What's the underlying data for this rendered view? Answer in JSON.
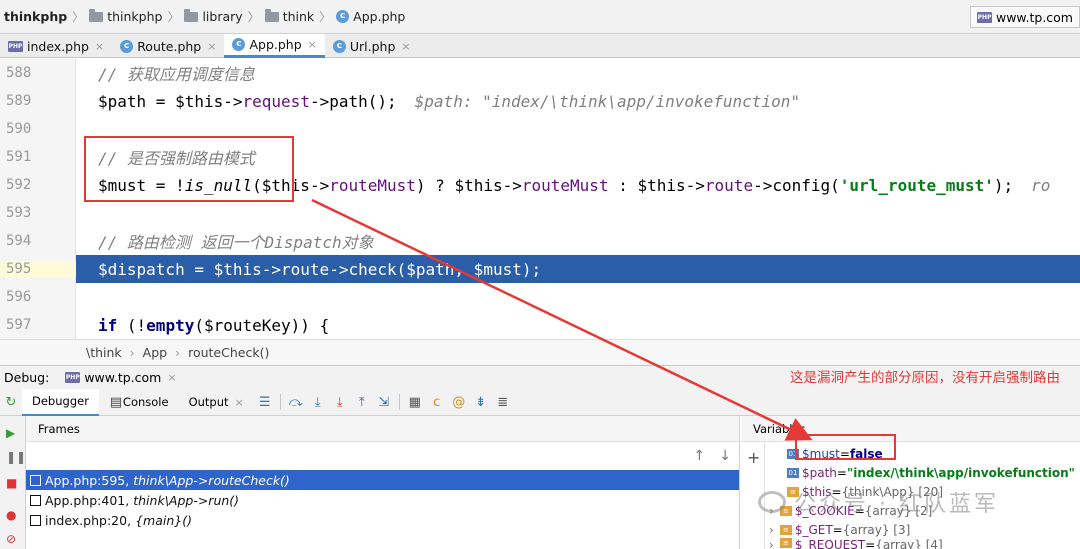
{
  "breadcrumb": {
    "items": [
      "thinkphp",
      "thinkphp",
      "library",
      "think",
      "App.php"
    ]
  },
  "run_config": {
    "label": "www.tp.com"
  },
  "tabs": [
    {
      "label": "index.php",
      "icon": "php-file-icon",
      "active": false,
      "close": "×"
    },
    {
      "label": "Route.php",
      "icon": "class-icon",
      "active": false,
      "close": "×"
    },
    {
      "label": "App.php",
      "icon": "class-icon",
      "active": true,
      "close": "×"
    },
    {
      "label": "Url.php",
      "icon": "class-icon",
      "active": false,
      "close": "×"
    }
  ],
  "editor": {
    "lines": [
      {
        "num": "588"
      },
      {
        "num": "589"
      },
      {
        "num": "590"
      },
      {
        "num": "591"
      },
      {
        "num": "592"
      },
      {
        "num": "593"
      },
      {
        "num": "594"
      },
      {
        "num": "595"
      },
      {
        "num": "596"
      },
      {
        "num": "597"
      }
    ],
    "code": {
      "l588_comment": "// 获取应用调度信息",
      "l589_a": "$path",
      "l589_b": " = ",
      "l589_c": "$this",
      "l589_d": "->",
      "l589_e": "request",
      "l589_f": "->path();",
      "l589_hint": "$path: \"index/\\think\\app/invokefunction\"",
      "l591_comment": "// 是否强制路由模式",
      "l592_a": "$must",
      "l592_b": " = !",
      "l592_c": "is_null",
      "l592_d": "($this->",
      "l592_e": "routeMust",
      "l592_f": ") ? $this->",
      "l592_g": "routeMust",
      "l592_h": " : $this->",
      "l592_i": "route",
      "l592_j": "->config(",
      "l592_k": "'url_route_must'",
      "l592_l": ");",
      "l592_hint": "ro",
      "l594_comment": "// 路由检测 返回一个Dispatch对象",
      "l595": "$dispatch = $this->route->check($path, $must);",
      "l597_a": "if",
      "l597_b": " (!",
      "l597_c": "empty",
      "l597_d": "($routeKey)) {"
    }
  },
  "editor_breadcrumb": [
    "\\think",
    "App",
    "routeCheck()"
  ],
  "debug": {
    "label": "Debug:",
    "session": "www.tp.com",
    "tabs": [
      "Debugger",
      "Console",
      "Output"
    ],
    "frames_title": "Frames",
    "frames": [
      {
        "loc": "App.php:595,",
        "method": "think\\App->routeCheck()",
        "selected": true
      },
      {
        "loc": "App.php:401,",
        "method": "think\\App->run()",
        "selected": false
      },
      {
        "loc": "index.php:20,",
        "method": "{main}()",
        "selected": false
      }
    ],
    "variables_title": "Variables",
    "variables": [
      {
        "name": "$must",
        "eq": " = ",
        "value": "false"
      },
      {
        "name": "$path",
        "eq": " = ",
        "value": "\"index/\\think\\app/invokefunction\""
      },
      {
        "name": "$this",
        "eq": " = ",
        "value": "{think\\App} [20]"
      },
      {
        "name": "$_COOKIE",
        "eq": " = ",
        "value": "{array} [2]"
      },
      {
        "name": "$_GET",
        "eq": " = ",
        "value": "{array} [3]"
      },
      {
        "name": "$_REQUEST",
        "eq": " = ",
        "value": "{array} [4]"
      }
    ]
  },
  "annotation": "这是漏洞产生的部分原因，没有开启强制路由",
  "watermark": "公众号 · 红队蓝军",
  "colors": {
    "accent": "#2b5ea8",
    "annotation": "#e53935",
    "selection": "#2f65ca"
  }
}
